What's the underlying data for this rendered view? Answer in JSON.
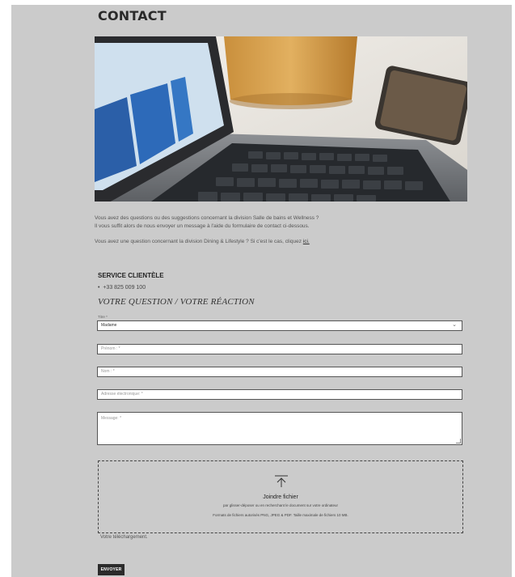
{
  "page": {
    "title": "CONTACT",
    "intro_line1": "Vous avez des questions ou des suggestions concernant la division Salle de bains et Wellness ?",
    "intro_line2": "Il vous suffit alors de nous envoyer un message à l'aide du formulaire de contact ci-dessous.",
    "intro_line3": "Vous avez une question concernant la division Dining & Lifestyle ? Si c'est le cas, cliquez",
    "intro_link": "ici.",
    "image_alt": "Laptop on a desk with a coffee cup and smartphone"
  },
  "service": {
    "title": "SERVICE CLIENTÈLE",
    "phone": "+33 825 009 100"
  },
  "form": {
    "section_title": "VOTRE QUESTION / VOTRE RÉACTION",
    "title_label": "Titre *",
    "title_value": "Madame",
    "firstname_placeholder": "Prénom : *",
    "lastname_placeholder": "Nom : *",
    "email_placeholder": "Adresse électronique: *",
    "message_placeholder": "Message: *",
    "attach_title": "Joindre fichier",
    "attach_sub": "par glisser-déposer ou en recherchant le document sur votre ordinateur",
    "attach_formats": "Formats de fichiers autorisés PNG, JPEG & PDF. Taille maximale de fichiers 10 MB.",
    "upload_note": "Votre téléchargement.",
    "submit_label": "ENVOYER"
  },
  "icons": {
    "chevron": "chevron-down-icon",
    "upload": "upload-arrow-icon",
    "bullet": "•"
  }
}
